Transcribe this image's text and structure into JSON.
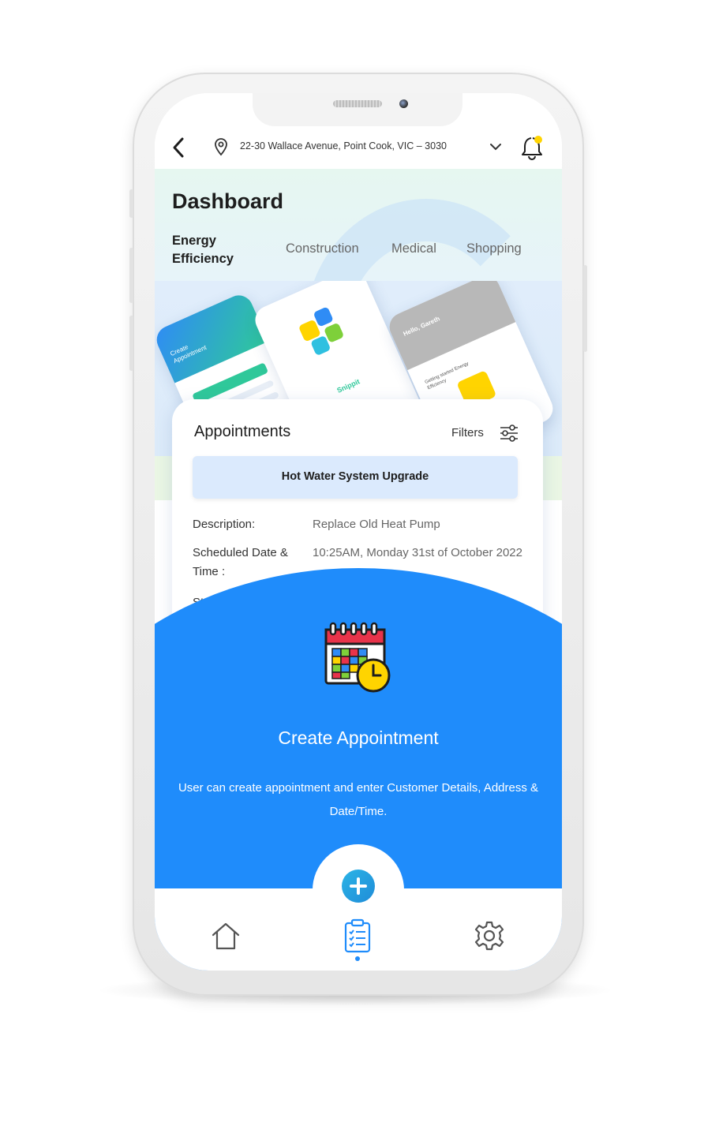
{
  "topbar": {
    "address": "22-30 Wallace Avenue, Point Cook, VIC – 3030"
  },
  "dashboard": {
    "title": "Dashboard",
    "tabs": [
      "Energy\nEfficiency",
      "Construction",
      "Medical",
      "Shopping"
    ],
    "active_tab_index": 0
  },
  "mockup_texts": {
    "card1_title": "Create Appointment",
    "card2_brand": "Snippit",
    "card3_greeting": "Hello, Gareth",
    "card3_sub": "Getting started Energy Efficiency"
  },
  "appointments": {
    "title": "Appointments",
    "filters_label": "Filters",
    "selected": "Hot Water System Upgrade",
    "rows": [
      {
        "label": "Description:",
        "value": "Replace Old Heat Pump"
      },
      {
        "label": "Scheduled Date & Time :",
        "value": "10:25AM, Monday 31st of October 2022"
      },
      {
        "label": "Status:",
        "value": ""
      }
    ]
  },
  "feature": {
    "icon": "calendar-clock-icon",
    "title": "Create Appointment",
    "description": "User can create appointment and enter Customer Details, Address & Date/Time."
  },
  "nav": {
    "items": [
      "home-icon",
      "clipboard-checklist-icon",
      "gear-icon"
    ],
    "active_index": 1
  },
  "colors": {
    "primary_blue": "#1f8cfb",
    "notification_dot": "#ffd400",
    "selected_bar": "#dbeafd"
  }
}
